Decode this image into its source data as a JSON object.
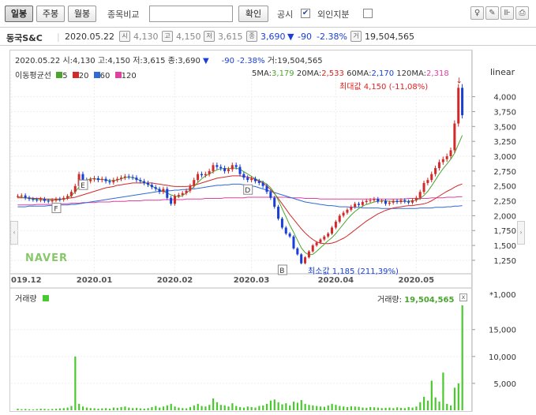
{
  "toolbar": {
    "period_buttons": [
      "일봉",
      "주봉",
      "월봉"
    ],
    "compare_label": "종목비교",
    "compare_input": "",
    "confirm_button": "확인",
    "notice_label": "공시",
    "notice_checked": true,
    "foreign_label": "외인지분",
    "foreign_checked": false
  },
  "info": {
    "name": "동국S&C",
    "date": "2020.05.22",
    "open": "4,130",
    "high": "4,150",
    "low": "3,615",
    "close": "3,690",
    "change": "-90",
    "change_pct": "-2.38%",
    "volume": "19,504,565",
    "arrow": "▼"
  },
  "ohlc_line": {
    "date": "2020.05.22",
    "open_label": "시:4,130",
    "high_label": "고:4,150",
    "low_label": "저:3,615",
    "close_label": "종:3,690",
    "arrow": "▼",
    "change": "-90",
    "change_pct": "-2.38%",
    "volume_label": "거:19,504,565"
  },
  "ma_legend": {
    "label": "이동평균선",
    "items": [
      {
        "label": "5",
        "color": "#4aa52f"
      },
      {
        "label": "20",
        "color": "#d22a2a"
      },
      {
        "label": "60",
        "color": "#2e6bd6"
      },
      {
        "label": "120",
        "color": "#e040a0"
      }
    ]
  },
  "ma_values": {
    "ma5_label": "5MA:",
    "ma5": "3,179",
    "ma20_label": "20MA:",
    "ma20": "2,533",
    "ma60_label": "60MA:",
    "ma60": "2,170",
    "ma120_label": "120MA:",
    "ma120": "2,318"
  },
  "scale_label": "linear",
  "max_note": "최대값 4,150 (-11,08%)",
  "min_note": "최소값 1,185 (211,39%)",
  "watermark": "NAVER",
  "volume_panel": {
    "title": "거래량",
    "current_label": "거래량:",
    "current_value": "19,504,565",
    "unit": "*1,000",
    "close_button": "x"
  },
  "colors": {
    "up": "#d22a2a",
    "down": "#1a3fd6",
    "volume": "#4ac92f",
    "ma5": "#4aa52f",
    "ma20": "#d22a2a",
    "ma60": "#2e6bd6",
    "ma120": "#e040a0"
  },
  "chart_data": {
    "type": "candlestick",
    "x_tick_labels": [
      "019.12",
      "2020.01",
      "2020.02",
      "2020.03",
      "2020.04",
      "2020.05"
    ],
    "y_ticks": [
      1250,
      1500,
      1750,
      2000,
      2250,
      2500,
      2750,
      3000,
      3250,
      3500,
      3750,
      4000
    ],
    "y_tick_labels": [
      "1,250",
      "1,500",
      "1,750",
      "2,000",
      "2,250",
      "2,500",
      "2,750",
      "3,000",
      "3,250",
      "3,500",
      "3,750",
      "4,000"
    ],
    "ylim": [
      1050,
      4300
    ],
    "event_markers": [
      "E",
      "F",
      "D",
      "B"
    ],
    "close": [
      2330,
      2340,
      2300,
      2280,
      2270,
      2260,
      2280,
      2250,
      2240,
      2260,
      2280,
      2270,
      2300,
      2330,
      2400,
      2500,
      2700,
      2600,
      2580,
      2610,
      2630,
      2600,
      2620,
      2580,
      2560,
      2600,
      2620,
      2640,
      2660,
      2650,
      2640,
      2600,
      2580,
      2550,
      2520,
      2480,
      2450,
      2400,
      2450,
      2300,
      2200,
      2330,
      2350,
      2380,
      2420,
      2500,
      2600,
      2700,
      2680,
      2700,
      2750,
      2850,
      2820,
      2800,
      2750,
      2780,
      2850,
      2820,
      2700,
      2640,
      2600,
      2620,
      2580,
      2550,
      2500,
      2400,
      2300,
      2150,
      1950,
      1800,
      1700,
      1650,
      1450,
      1350,
      1200,
      1300,
      1400,
      1500,
      1550,
      1600,
      1650,
      1700,
      1800,
      1900,
      2000,
      2050,
      2100,
      2150,
      2200,
      2180,
      2230,
      2250,
      2260,
      2280,
      2240,
      2250,
      2200,
      2220,
      2250,
      2230,
      2260,
      2240,
      2220,
      2260,
      2300,
      2400,
      2550,
      2600,
      2700,
      2800,
      2900,
      2950,
      3000,
      3100,
      3550,
      4150,
      3690
    ],
    "ma5": [
      2320,
      2310,
      2300,
      2290,
      2280,
      2270,
      2270,
      2260,
      2260,
      2260,
      2260,
      2270,
      2280,
      2300,
      2340,
      2400,
      2480,
      2560,
      2600,
      2620,
      2620,
      2610,
      2610,
      2600,
      2590,
      2590,
      2600,
      2620,
      2640,
      2650,
      2640,
      2620,
      2590,
      2560,
      2530,
      2500,
      2460,
      2430,
      2410,
      2380,
      2350,
      2330,
      2320,
      2340,
      2380,
      2430,
      2490,
      2560,
      2620,
      2670,
      2700,
      2740,
      2770,
      2790,
      2790,
      2790,
      2800,
      2800,
      2780,
      2740,
      2700,
      2660,
      2620,
      2590,
      2570,
      2530,
      2470,
      2380,
      2260,
      2120,
      1980,
      1840,
      1720,
      1590,
      1460,
      1380,
      1340,
      1350,
      1400,
      1460,
      1520,
      1580,
      1630,
      1700,
      1780,
      1860,
      1940,
      2010,
      2070,
      2120,
      2160,
      2190,
      2210,
      2230,
      2240,
      2250,
      2250,
      2240,
      2240,
      2240,
      2240,
      2240,
      2240,
      2250,
      2260,
      2290,
      2340,
      2410,
      2500,
      2600,
      2700,
      2790,
      2870,
      2950,
      3050,
      3200,
      3350
    ],
    "ma20": [
      2300,
      2300,
      2300,
      2300,
      2290,
      2290,
      2290,
      2280,
      2280,
      2280,
      2280,
      2280,
      2280,
      2290,
      2300,
      2310,
      2330,
      2350,
      2370,
      2390,
      2410,
      2430,
      2450,
      2470,
      2480,
      2490,
      2510,
      2520,
      2530,
      2540,
      2550,
      2550,
      2550,
      2550,
      2550,
      2550,
      2540,
      2530,
      2520,
      2510,
      2500,
      2490,
      2490,
      2490,
      2490,
      2500,
      2510,
      2530,
      2550,
      2570,
      2590,
      2610,
      2630,
      2640,
      2650,
      2660,
      2670,
      2670,
      2670,
      2660,
      2650,
      2630,
      2610,
      2580,
      2550,
      2500,
      2440,
      2370,
      2290,
      2200,
      2110,
      2020,
      1940,
      1860,
      1780,
      1710,
      1650,
      1600,
      1560,
      1540,
      1530,
      1530,
      1540,
      1560,
      1590,
      1620,
      1660,
      1710,
      1760,
      1810,
      1860,
      1910,
      1950,
      1990,
      2030,
      2060,
      2090,
      2110,
      2130,
      2140,
      2150,
      2160,
      2170,
      2170,
      2180,
      2190,
      2200,
      2220,
      2250,
      2290,
      2330,
      2370,
      2410,
      2440,
      2480,
      2510,
      2533
    ],
    "ma60": [
      2150,
      2150,
      2150,
      2160,
      2160,
      2160,
      2160,
      2160,
      2170,
      2170,
      2170,
      2180,
      2180,
      2180,
      2190,
      2190,
      2200,
      2210,
      2220,
      2230,
      2240,
      2250,
      2260,
      2270,
      2280,
      2290,
      2300,
      2310,
      2320,
      2330,
      2340,
      2350,
      2360,
      2370,
      2380,
      2390,
      2400,
      2410,
      2410,
      2420,
      2420,
      2430,
      2430,
      2440,
      2440,
      2450,
      2450,
      2460,
      2470,
      2480,
      2490,
      2500,
      2510,
      2510,
      2520,
      2520,
      2530,
      2530,
      2530,
      2520,
      2510,
      2500,
      2490,
      2470,
      2450,
      2430,
      2410,
      2390,
      2370,
      2350,
      2330,
      2310,
      2290,
      2270,
      2250,
      2230,
      2220,
      2210,
      2200,
      2190,
      2180,
      2170,
      2170,
      2160,
      2150,
      2150,
      2150,
      2140,
      2140,
      2140,
      2130,
      2130,
      2130,
      2130,
      2130,
      2120,
      2120,
      2120,
      2120,
      2120,
      2120,
      2120,
      2120,
      2120,
      2120,
      2130,
      2130,
      2130,
      2130,
      2140,
      2140,
      2140,
      2150,
      2150,
      2160,
      2160,
      2170
    ],
    "ma120": [
      2180,
      2180,
      2180,
      2180,
      2180,
      2190,
      2190,
      2190,
      2190,
      2190,
      2200,
      2200,
      2200,
      2200,
      2210,
      2210,
      2210,
      2220,
      2220,
      2220,
      2220,
      2230,
      2230,
      2230,
      2230,
      2240,
      2240,
      2240,
      2240,
      2250,
      2250,
      2250,
      2250,
      2260,
      2260,
      2260,
      2260,
      2260,
      2270,
      2270,
      2270,
      2270,
      2270,
      2270,
      2280,
      2280,
      2280,
      2280,
      2280,
      2290,
      2290,
      2290,
      2290,
      2290,
      2300,
      2300,
      2300,
      2300,
      2300,
      2300,
      2310,
      2310,
      2310,
      2310,
      2310,
      2310,
      2310,
      2310,
      2310,
      2310,
      2310,
      2300,
      2300,
      2300,
      2300,
      2290,
      2290,
      2290,
      2290,
      2280,
      2280,
      2280,
      2280,
      2280,
      2280,
      2280,
      2280,
      2280,
      2280,
      2280,
      2280,
      2280,
      2280,
      2280,
      2280,
      2280,
      2280,
      2280,
      2280,
      2280,
      2280,
      2280,
      2290,
      2290,
      2290,
      2290,
      2290,
      2290,
      2300,
      2300,
      2300,
      2300,
      2310,
      2310,
      2310,
      2318,
      2318
    ],
    "volume_ticks": [
      5000,
      10000,
      15000
    ],
    "volume_tick_labels": [
      "5,000",
      "10,000",
      "15,000"
    ],
    "volume_ylim": [
      0,
      19800
    ],
    "volume": [
      300,
      200,
      250,
      180,
      150,
      220,
      300,
      260,
      200,
      240,
      280,
      350,
      400,
      500,
      800,
      10000,
      1200,
      700,
      500,
      400,
      380,
      300,
      350,
      400,
      300,
      500,
      450,
      600,
      700,
      500,
      400,
      450,
      350,
      300,
      400,
      600,
      800,
      500,
      700,
      900,
      1200,
      700,
      500,
      400,
      350,
      600,
      900,
      1200,
      800,
      700,
      1000,
      2200,
      1500,
      1000,
      900,
      700,
      1300,
      800,
      600,
      500,
      700,
      600,
      500,
      800,
      900,
      1200,
      1800,
      2000,
      1500,
      1100,
      1300,
      900,
      1600,
      1400,
      1900,
      1200,
      1000,
      900,
      800,
      700,
      650,
      900,
      1200,
      1000,
      800,
      700,
      600,
      750,
      700,
      650,
      500,
      450,
      600,
      550,
      500,
      400,
      450,
      500,
      400,
      550,
      450,
      400,
      600,
      500,
      700,
      1500,
      2500,
      1800,
      5500,
      2400,
      1600,
      7000,
      1200,
      900,
      4200,
      5000,
      19505
    ]
  }
}
